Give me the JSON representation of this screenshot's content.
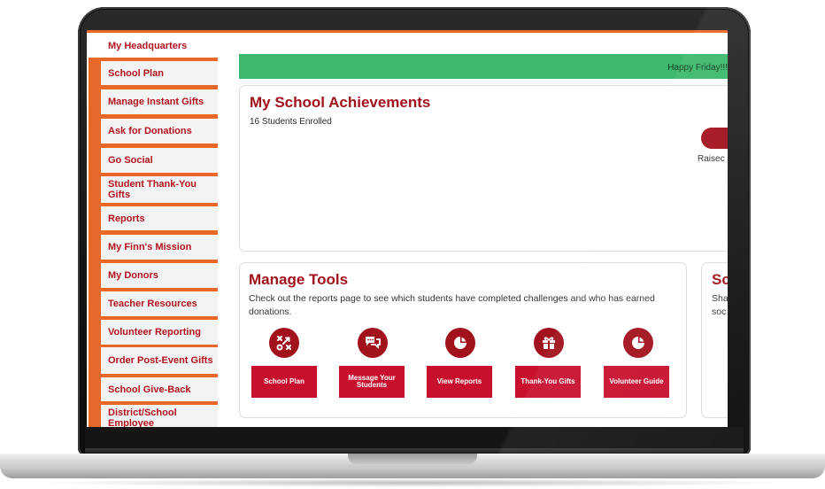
{
  "sidebar": {
    "header": "My Headquarters",
    "items": [
      {
        "label": "School Plan"
      },
      {
        "label": "Manage Instant Gifts"
      },
      {
        "label": "Ask for Donations"
      },
      {
        "label": "Go Social"
      },
      {
        "label": "Student Thank-You Gifts"
      },
      {
        "label": "Reports"
      },
      {
        "label": "My Finn's Mission"
      },
      {
        "label": "My Donors"
      },
      {
        "label": "Teacher Resources"
      },
      {
        "label": "Volunteer Reporting"
      },
      {
        "label": "Order Post-Event Gifts"
      },
      {
        "label": "School Give-Back"
      },
      {
        "label": "District/School Employee"
      }
    ]
  },
  "banner": {
    "text": "Happy Friday!!!"
  },
  "achievements": {
    "title": "My School Achievements",
    "enrolled": "16 Students Enrolled",
    "raised_label": "Raisec"
  },
  "tools": {
    "title": "Manage Tools",
    "description": "Check out the reports page to see which students have completed challenges and who has earned donations.",
    "buttons": [
      {
        "label": "School Plan",
        "icon": "strategy-icon"
      },
      {
        "label": "Message Your Students",
        "icon": "chat-icon"
      },
      {
        "label": "View Reports",
        "icon": "pie-chart-icon"
      },
      {
        "label": "Thank-You Gifts",
        "icon": "gift-icon"
      },
      {
        "label": "Volunteer Guide",
        "icon": "pie-chart-icon"
      }
    ]
  },
  "social": {
    "title": "Sc",
    "line1": "Sha",
    "line2": "soc"
  },
  "colors": {
    "brand_red": "#a2121c",
    "button_red": "#c8102e",
    "sidebar_orange": "#e8682a",
    "banner_green": "#3cb96c"
  }
}
